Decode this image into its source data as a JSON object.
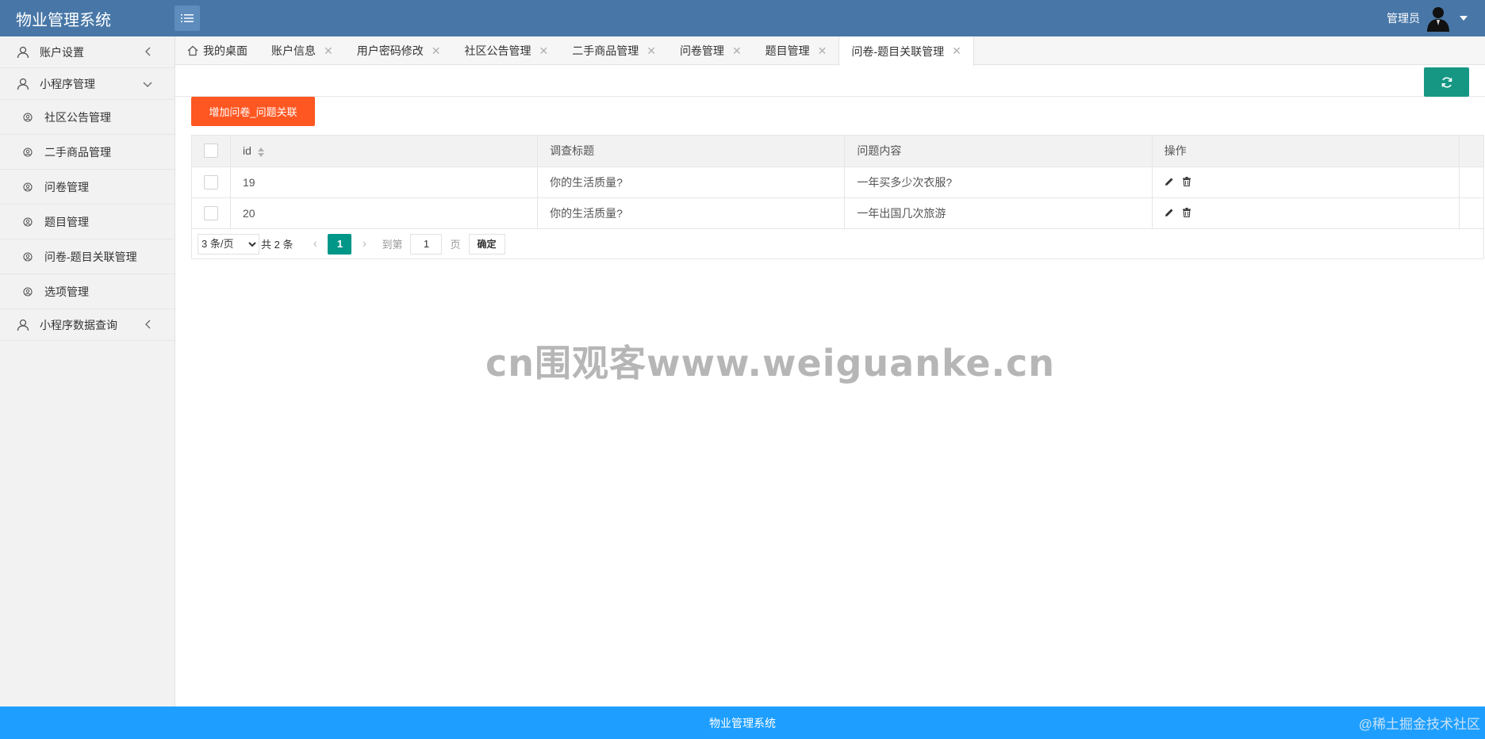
{
  "app": {
    "title": "物业管理系统"
  },
  "header": {
    "user_name": "管理员"
  },
  "sidebar": {
    "items": [
      {
        "label": "账户设置"
      },
      {
        "label": "小程序管理"
      },
      {
        "label": "小程序数据查询"
      }
    ],
    "sub_items": [
      {
        "label": "社区公告管理"
      },
      {
        "label": "二手商品管理"
      },
      {
        "label": "问卷管理"
      },
      {
        "label": "题目管理"
      },
      {
        "label": "问卷-题目关联管理"
      },
      {
        "label": "选项管理"
      }
    ]
  },
  "tabs": [
    {
      "label": "我的桌面"
    },
    {
      "label": "账户信息"
    },
    {
      "label": "用户密码修改"
    },
    {
      "label": "社区公告管理"
    },
    {
      "label": "二手商品管理"
    },
    {
      "label": "问卷管理"
    },
    {
      "label": "题目管理"
    },
    {
      "label": "问卷-题目关联管理"
    }
  ],
  "toolbar": {
    "add_label": "增加问卷_问题关联"
  },
  "table": {
    "columns": [
      "id",
      "调查标题",
      "问题内容",
      "操作"
    ],
    "rows": [
      {
        "id": "19",
        "title": "你的生活质量?",
        "question": "一年买多少次衣服?"
      },
      {
        "id": "20",
        "title": "你的生活质量?",
        "question": "一年出国几次旅游"
      }
    ]
  },
  "pager": {
    "page_size_option": "3 条/页",
    "total": "共 2 条",
    "current": "1",
    "goto_label": "到第",
    "goto_value": "1",
    "page_unit": "页",
    "confirm_label": "确定"
  },
  "watermark": "cn围观客www.weiguanke.cn",
  "footer": {
    "text": "物业管理系统",
    "community": "@稀土掘金技术社区"
  },
  "colors": {
    "header": "#4877a7",
    "accent_green": "#009688",
    "add_button": "#ff5722",
    "footer": "#1e9fff"
  }
}
